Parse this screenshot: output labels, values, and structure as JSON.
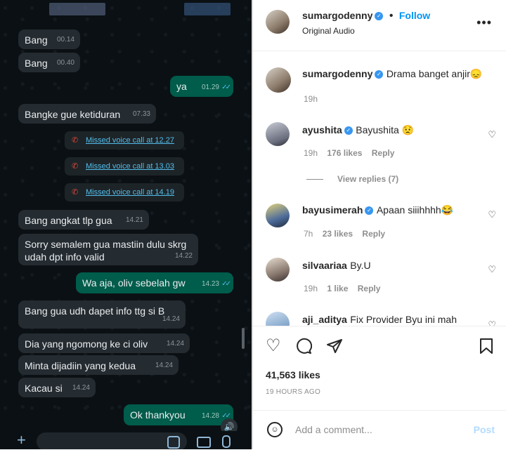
{
  "chat": {
    "messages": [
      {
        "text": "Bang",
        "time": "00.14"
      },
      {
        "text": "Bang",
        "time": "00.40"
      },
      {
        "text": "ya",
        "time": "01.29"
      },
      {
        "text": "Bangke gue ketiduran",
        "time": "07.33"
      },
      {
        "text": "Missed voice call at 12.27"
      },
      {
        "text": "Missed voice call at 13.03"
      },
      {
        "text": "Missed voice call at 14.19"
      },
      {
        "text": "Bang angkat tlp gua",
        "time": "14.21"
      },
      {
        "text": "Sorry semalem gua mastiin dulu skrg",
        "text2": "udah dpt info valid",
        "time": "14.22"
      },
      {
        "text": "Wa aja, oliv sebelah gw",
        "time": "14.23"
      },
      {
        "text": "Bang gua udh dapet info ttg si B",
        "time": "14.24"
      },
      {
        "text": "Dia yang ngomong ke ci oliv",
        "time": "14.24"
      },
      {
        "text": "Minta dijadiin yang kedua",
        "time": "14.24"
      },
      {
        "text": "Kacau si",
        "time": "14.24"
      },
      {
        "text": "Ok thankyou",
        "time": "14.28"
      }
    ]
  },
  "post": {
    "author": "sumargodenny",
    "follow_label": "Follow",
    "audio": "Original Audio",
    "more_icon": "more-dots-icon",
    "caption": {
      "user": "sumargodenny",
      "text": "Drama banget anjir😞",
      "time": "19h"
    },
    "comments": [
      {
        "user": "ayushita",
        "text": "Bayushita 😟",
        "time": "19h",
        "likes": "176 likes",
        "reply": "Reply",
        "view_replies": "View replies (7)"
      },
      {
        "user": "bayusimerah",
        "text": "Apaan siiihhhh😂",
        "time": "7h",
        "likes": "23 likes",
        "reply": "Reply"
      },
      {
        "user": "silvaariaa",
        "text": "By.U",
        "time": "19h",
        "likes": "1 like",
        "reply": "Reply"
      },
      {
        "user": "aji_aditya",
        "text": "Fix Provider Byu ini mah"
      }
    ],
    "likes_count": "41,563 likes",
    "posted_ago": "19 HOURS AGO",
    "add_comment_placeholder": "Add a comment...",
    "post_label": "Post"
  },
  "colors": {
    "whatsapp_outgoing": "#005c4b",
    "whatsapp_incoming": "#242b31",
    "instagram_link": "#0095f6"
  }
}
